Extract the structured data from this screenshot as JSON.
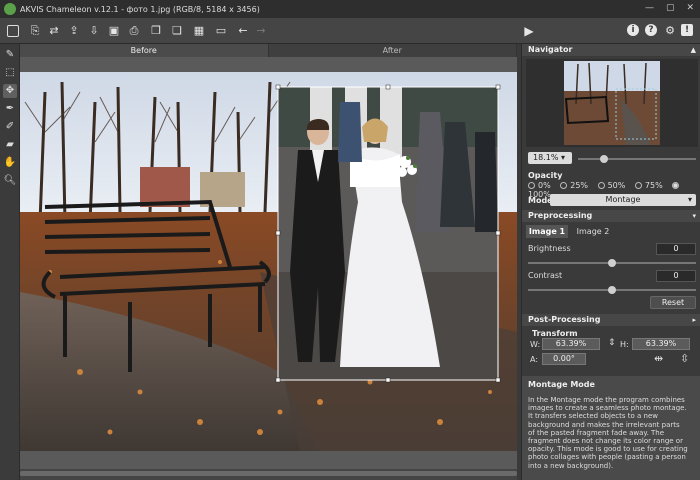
{
  "app": {
    "title": "AKVIS Chameleon v.12.1 - фото 1.jpg (RGB/8, 5184 x 3456)",
    "window_controls": [
      "—",
      "▢",
      "✕"
    ]
  },
  "toolbar": {
    "icons": [
      "crop-frame-icon",
      "open-file-icon",
      "swap-icon",
      "export-icon",
      "import-icon",
      "save-icon",
      "print-icon",
      "copy-layer-icon",
      "paste-layer-icon",
      "batch-icon",
      "ruler-icon",
      "undo-icon",
      "redo-icon"
    ],
    "run_icon": "play-icon",
    "right_icons": [
      "info-icon",
      "help-icon",
      "settings-icon",
      "feedback-icon"
    ],
    "glyphs": {
      "info": "i",
      "help": "?",
      "settings": "⚙",
      "feedback": "!"
    }
  },
  "view_tabs": {
    "before": "Before",
    "after": "After"
  },
  "navigator": {
    "title": "Navigator",
    "zoom": "18.1%"
  },
  "opacity": {
    "label": "Opacity",
    "options": [
      "0%",
      "25%",
      "50%",
      "75%",
      "100%"
    ],
    "selected": "100%"
  },
  "mode": {
    "label": "Mode",
    "value": "Montage"
  },
  "preprocessing": {
    "title": "Preprocessing",
    "tabs": [
      "Image 1",
      "Image 2"
    ],
    "active_tab": "Image 1",
    "brightness_label": "Brightness",
    "brightness_value": "0",
    "contrast_label": "Contrast",
    "contrast_value": "0",
    "reset_label": "Reset"
  },
  "postprocessing": {
    "title": "Post-Processing"
  },
  "transform": {
    "title": "Transform",
    "w_label": "W:",
    "w_value": "63.39%",
    "h_label": "H:",
    "h_value": "63.39%",
    "a_label": "A:",
    "a_value": "0.00°"
  },
  "help": {
    "title": "Montage Mode",
    "text": "In the Montage mode the program combines images to create a seamless photo montage. It transfers selected objects to a new background and makes the irrelevant parts of the pasted fragment fade away. The fragment does not change its color range or opacity. This mode is good to use for creating photo collages with people (pasting a person into a new background)."
  },
  "colors": {
    "accent_logo": "#5aa14a",
    "bg": "#3a3a3a",
    "panel_header": "#474747"
  }
}
